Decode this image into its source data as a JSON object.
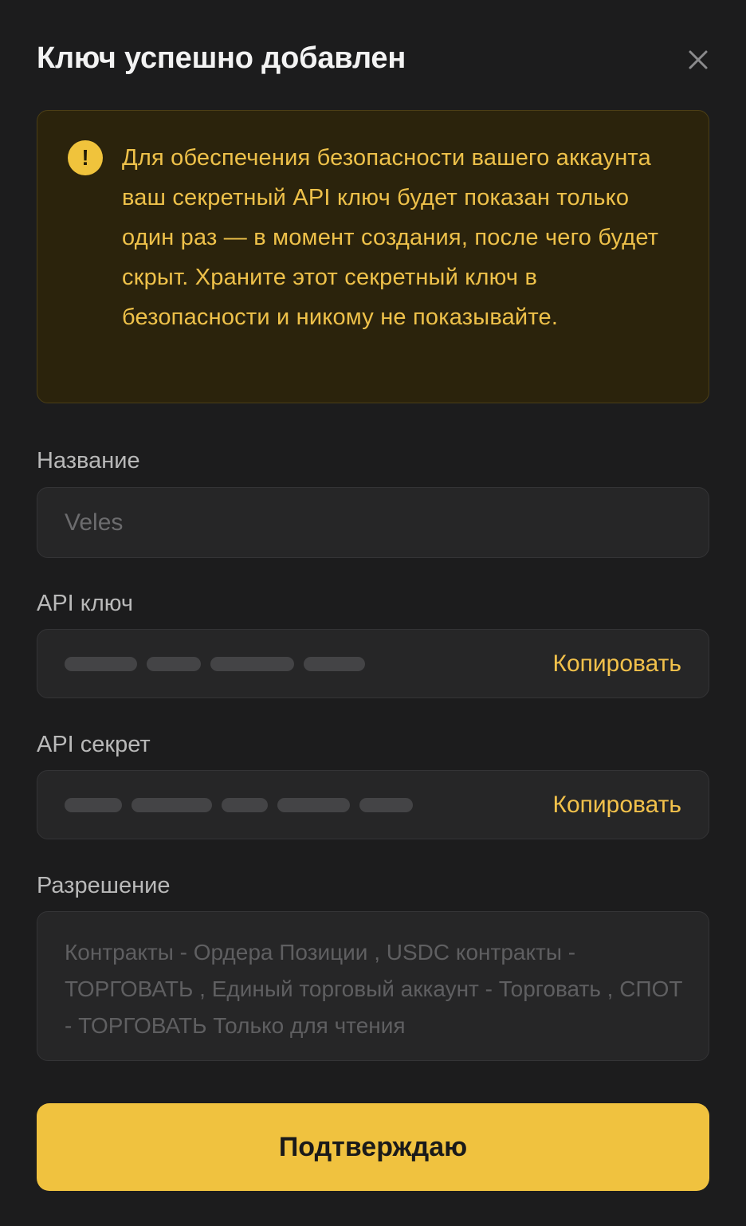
{
  "dialog": {
    "title": "Ключ успешно добавлен",
    "close_icon": "close-icon"
  },
  "warning": {
    "icon": "exclamation-icon",
    "text": "Для обеспечения безопасности вашего аккаунта ваш секретный API ключ будет показан только один раз — в момент создания, после чего будет скрыт. Храните этот секретный ключ в безопасности и никому не показывайте.",
    "icon_color": "#f0c33c",
    "text_color": "#eec14a"
  },
  "name_field": {
    "label": "Название",
    "value": "Veles"
  },
  "api_key": {
    "label": "API ключ",
    "copy_label": "Копировать"
  },
  "api_secret": {
    "label": "API секрет",
    "copy_label": "Копировать"
  },
  "permissions": {
    "label": "Разрешение",
    "value": "Контракты - Ордера Позиции , USDC контракты - ТОРГОВАТЬ , Единый торговый аккаунт - Торговать , СПОТ - ТОРГОВАТЬ Только для чтения"
  },
  "confirm": {
    "label": "Подтверждаю"
  },
  "colors": {
    "background": "#1c1c1d",
    "accent": "#f0c23f",
    "field_bg": "#262627"
  }
}
